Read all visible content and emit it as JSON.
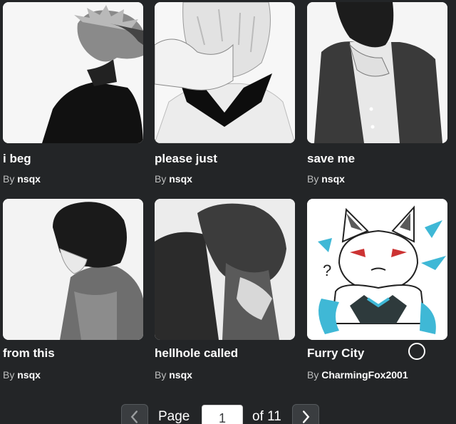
{
  "items": [
    {
      "title": "i beg",
      "by": "By",
      "creator": "nsqx"
    },
    {
      "title": "please just",
      "by": "By",
      "creator": "nsqx"
    },
    {
      "title": "save me",
      "by": "By",
      "creator": "nsqx"
    },
    {
      "title": "from this",
      "by": "By",
      "creator": "nsqx"
    },
    {
      "title": "hellhole called",
      "by": "By",
      "creator": "nsqx"
    },
    {
      "title": "Furry City",
      "by": "By",
      "creator": "CharmingFox2001"
    }
  ],
  "pagination": {
    "page_label": "Page",
    "current_page": "1",
    "of_label": "of 11",
    "prev_icon": "chevron-left-icon",
    "next_icon": "chevron-right-icon"
  },
  "colors": {
    "background": "#232527",
    "title_text": "#ffffff",
    "byline_text": "#bdbebe",
    "thumb_bg": "#f4f4f4"
  }
}
